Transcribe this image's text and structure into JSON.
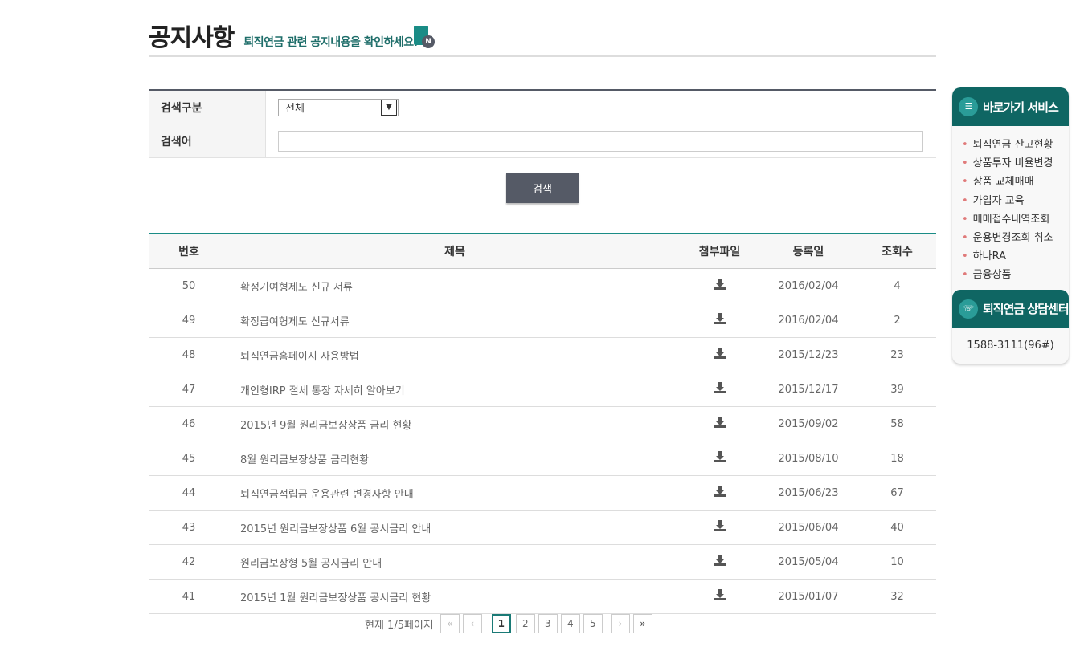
{
  "header": {
    "title": "공지사항",
    "subtitle": "퇴직연금 관련 공지내용을 확인하세요.",
    "badge": "N"
  },
  "search": {
    "type_label": "검색구분",
    "type_value": "전체",
    "keyword_label": "검색어",
    "keyword_value": "",
    "button": "검색"
  },
  "table": {
    "headers": [
      "번호",
      "제목",
      "첨부파일",
      "등록일",
      "조회수"
    ],
    "rows": [
      {
        "no": "50",
        "title": "확정기여형제도 신규 서류",
        "date": "2016/02/04",
        "views": "4"
      },
      {
        "no": "49",
        "title": "확정급여형제도 신규서류",
        "date": "2016/02/04",
        "views": "2"
      },
      {
        "no": "48",
        "title": "퇴직연금홈페이지 사용방법",
        "date": "2015/12/23",
        "views": "23"
      },
      {
        "no": "47",
        "title": "개인형IRP 절세 통장 자세히 알아보기",
        "date": "2015/12/17",
        "views": "39"
      },
      {
        "no": "46",
        "title": "2015년 9월 원리금보장상품 금리 현황",
        "date": "2015/09/02",
        "views": "58"
      },
      {
        "no": "45",
        "title": "8월 원리금보장상품 금리현황",
        "date": "2015/08/10",
        "views": "18"
      },
      {
        "no": "44",
        "title": "퇴직연금적립금 운용관련 변경사항 안내",
        "date": "2015/06/23",
        "views": "67"
      },
      {
        "no": "43",
        "title": "2015년 원리금보장상품 6월 공시금리 안내",
        "date": "2015/06/04",
        "views": "40"
      },
      {
        "no": "42",
        "title": "원리금보장형 5월 공시금리 안내",
        "date": "2015/05/04",
        "views": "10"
      },
      {
        "no": "41",
        "title": "2015년 1월 원리금보장상품 공시금리 현황",
        "date": "2015/01/07",
        "views": "32"
      }
    ]
  },
  "pager": {
    "current_text": "현재 1/5페이지",
    "first": "«",
    "prev": "‹",
    "pages": [
      "1",
      "2",
      "3",
      "4",
      "5"
    ],
    "next": "›",
    "last": "»"
  },
  "sidebar": {
    "quick_title": "바로가기 서비스",
    "items": [
      "퇴직연금 잔고현황",
      "상품투자 비율변경",
      "상품 교체매매",
      "가입자 교육",
      "매매접수내역조회",
      "운용변경조회 취소",
      "하나RA",
      "금융상품"
    ],
    "center_title": "퇴직연금 상담센터",
    "phone": "1588-3111(96#)"
  }
}
